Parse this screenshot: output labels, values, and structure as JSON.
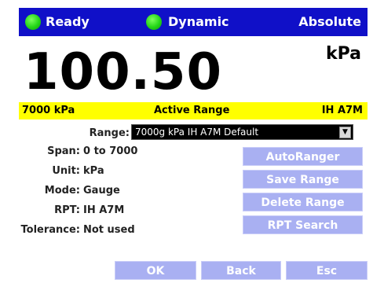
{
  "status": {
    "ready_label": "Ready",
    "dynamic_label": "Dynamic",
    "absolute_label": "Absolute",
    "led_color": "#23d617",
    "bar_color": "#1010c8"
  },
  "reading": {
    "value": "100.50",
    "unit": "kPa"
  },
  "banner": {
    "left": "7000 kPa",
    "center": "Active Range",
    "right": "IH A7M",
    "color": "#ffff00"
  },
  "form": {
    "range_label": "Range:",
    "range_value": "7000g kPa IH A7M Default",
    "span_label": "Span:",
    "span_value": "0 to 7000",
    "unit_label": "Unit:",
    "unit_value": "kPa",
    "mode_label": "Mode:",
    "mode_value": "Gauge",
    "rpt_label": "RPT:",
    "rpt_value": "IH A7M",
    "dut_label": "DUT Tolerance:",
    "dut_value": "Not used"
  },
  "buttons": {
    "autoranger": "AutoRanger",
    "save_range": "Save Range",
    "delete_range": "Delete Range",
    "rpt_search": "RPT Search",
    "ok": "OK",
    "back": "Back",
    "esc": "Esc",
    "color": "#a9b0f2"
  }
}
